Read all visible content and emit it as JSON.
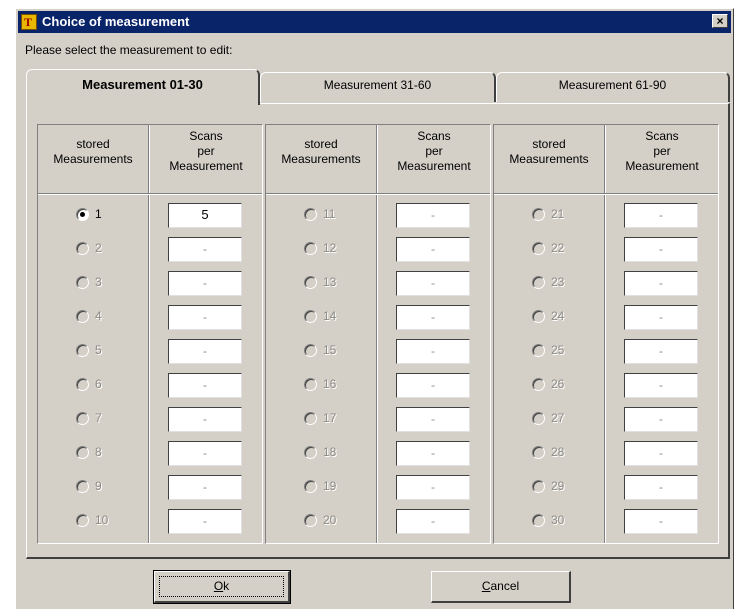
{
  "window": {
    "title": "Choice of measurement",
    "icon_text": "T",
    "close_label": "×"
  },
  "prompt": "Please select the measurement to edit:",
  "tabs": [
    {
      "label": "Measurement 01-30",
      "active": true
    },
    {
      "label": "Measurement 31-60",
      "active": false
    },
    {
      "label": "Measurement 61-90",
      "active": false
    }
  ],
  "columns": {
    "stored_header": "stored\nMeasurements",
    "scans_header": "Scans\nper\nMeasurement"
  },
  "groups": [
    {
      "rows": [
        {
          "label": "1",
          "value": "5",
          "checked": true,
          "enabled": true
        },
        {
          "label": "2",
          "value": "-",
          "checked": false,
          "enabled": false
        },
        {
          "label": "3",
          "value": "-",
          "checked": false,
          "enabled": false
        },
        {
          "label": "4",
          "value": "-",
          "checked": false,
          "enabled": false
        },
        {
          "label": "5",
          "value": "-",
          "checked": false,
          "enabled": false
        },
        {
          "label": "6",
          "value": "-",
          "checked": false,
          "enabled": false
        },
        {
          "label": "7",
          "value": "-",
          "checked": false,
          "enabled": false
        },
        {
          "label": "8",
          "value": "-",
          "checked": false,
          "enabled": false
        },
        {
          "label": "9",
          "value": "-",
          "checked": false,
          "enabled": false
        },
        {
          "label": "10",
          "value": "-",
          "checked": false,
          "enabled": false
        }
      ]
    },
    {
      "rows": [
        {
          "label": "11",
          "value": "-",
          "checked": false,
          "enabled": false
        },
        {
          "label": "12",
          "value": "-",
          "checked": false,
          "enabled": false
        },
        {
          "label": "13",
          "value": "-",
          "checked": false,
          "enabled": false
        },
        {
          "label": "14",
          "value": "-",
          "checked": false,
          "enabled": false
        },
        {
          "label": "15",
          "value": "-",
          "checked": false,
          "enabled": false
        },
        {
          "label": "16",
          "value": "-",
          "checked": false,
          "enabled": false
        },
        {
          "label": "17",
          "value": "-",
          "checked": false,
          "enabled": false
        },
        {
          "label": "18",
          "value": "-",
          "checked": false,
          "enabled": false
        },
        {
          "label": "19",
          "value": "-",
          "checked": false,
          "enabled": false
        },
        {
          "label": "20",
          "value": "-",
          "checked": false,
          "enabled": false
        }
      ]
    },
    {
      "rows": [
        {
          "label": "21",
          "value": "-",
          "checked": false,
          "enabled": false
        },
        {
          "label": "22",
          "value": "-",
          "checked": false,
          "enabled": false
        },
        {
          "label": "23",
          "value": "-",
          "checked": false,
          "enabled": false
        },
        {
          "label": "24",
          "value": "-",
          "checked": false,
          "enabled": false
        },
        {
          "label": "25",
          "value": "-",
          "checked": false,
          "enabled": false
        },
        {
          "label": "26",
          "value": "-",
          "checked": false,
          "enabled": false
        },
        {
          "label": "27",
          "value": "-",
          "checked": false,
          "enabled": false
        },
        {
          "label": "28",
          "value": "-",
          "checked": false,
          "enabled": false
        },
        {
          "label": "29",
          "value": "-",
          "checked": false,
          "enabled": false
        },
        {
          "label": "30",
          "value": "-",
          "checked": false,
          "enabled": false
        }
      ]
    }
  ],
  "buttons": {
    "ok": {
      "label": "Ok",
      "mnemonic": "O"
    },
    "cancel": {
      "label": "Cancel",
      "mnemonic": "C"
    }
  },
  "colors": {
    "titlebar": "#0a246a",
    "face": "#d4d0c8",
    "disabled_text": "#8f8c86"
  }
}
